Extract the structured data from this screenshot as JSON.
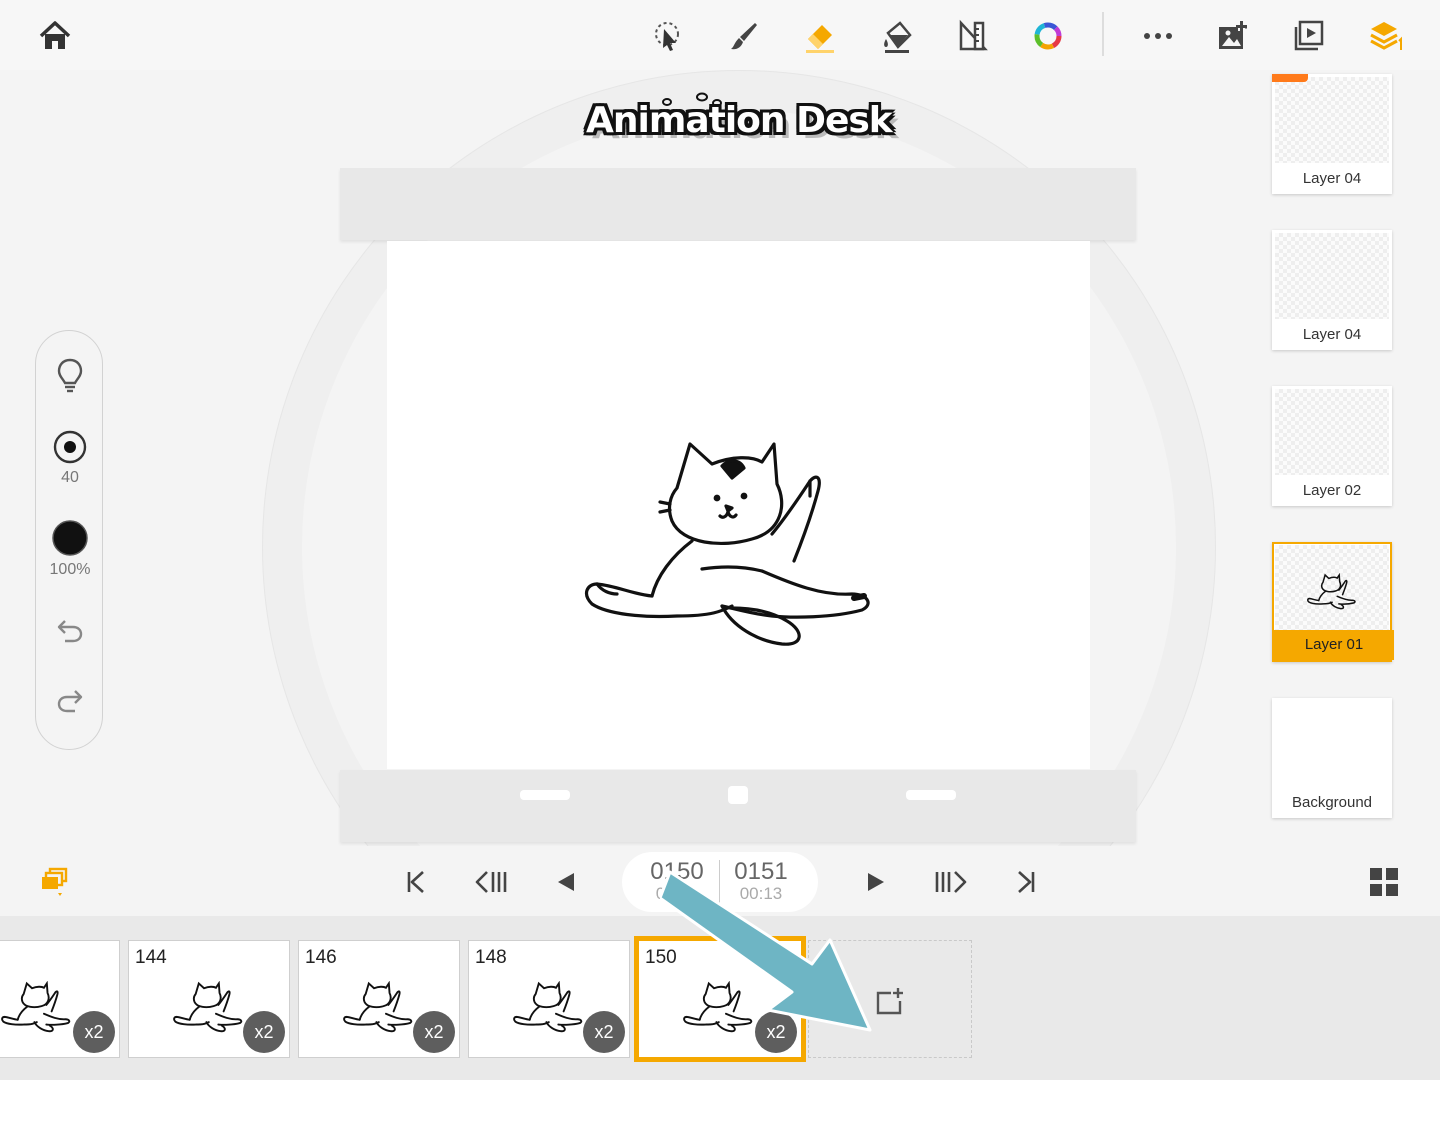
{
  "app": {
    "name": "Animation Desk"
  },
  "colors": {
    "accent": "#f5a800",
    "arrow": "#6eb5c4",
    "badge": "#5e5e5e",
    "pro": "#ff7a1a"
  },
  "toolbar": {
    "left": [
      {
        "icon": "home-icon"
      }
    ],
    "tools": [
      {
        "icon": "lasso-select-icon"
      },
      {
        "icon": "brush-icon"
      },
      {
        "icon": "eraser-icon",
        "active": true
      },
      {
        "icon": "fill-bucket-icon"
      },
      {
        "icon": "ruler-icon"
      },
      {
        "icon": "color-wheel-icon"
      }
    ],
    "right": [
      {
        "icon": "more-icon"
      },
      {
        "icon": "add-image-icon"
      },
      {
        "icon": "playback-preview-icon"
      },
      {
        "icon": "layers-icon"
      }
    ]
  },
  "tool_panel": {
    "brush_size": "40",
    "opacity": "100%"
  },
  "layers": [
    {
      "label": "Layer 04",
      "pro": true
    },
    {
      "label": "Layer 04"
    },
    {
      "label": "Layer 02"
    },
    {
      "label": "Layer 01",
      "active": true
    },
    {
      "label": "Background"
    }
  ],
  "playback": {
    "current_frame": "0150",
    "current_time": "00:12",
    "next_frame": "0151",
    "next_time": "00:13"
  },
  "filmstrip": {
    "frames": [
      {
        "number": "",
        "multiplier": "x2"
      },
      {
        "number": "144",
        "multiplier": "x2"
      },
      {
        "number": "146",
        "multiplier": "x2"
      },
      {
        "number": "148",
        "multiplier": "x2"
      },
      {
        "number": "150",
        "multiplier": "x2",
        "current": true
      }
    ]
  }
}
